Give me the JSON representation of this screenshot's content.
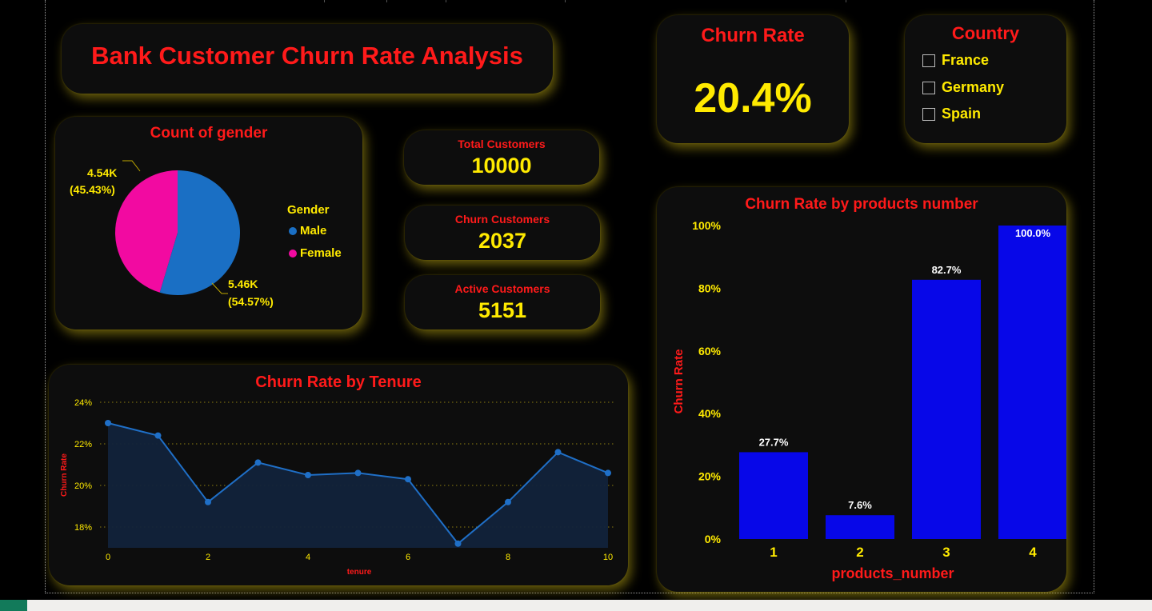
{
  "dashboard": {
    "title": "Bank Customer Churn Rate Analysis"
  },
  "kpis": {
    "churn_rate": {
      "label": "Churn Rate",
      "value": "20.4%"
    },
    "total_customers": {
      "label": "Total Customers",
      "value": "10000"
    },
    "churn_customers": {
      "label": "Churn Customers",
      "value": "2037"
    },
    "active_customers": {
      "label": "Active Customers",
      "value": "5151"
    }
  },
  "country_filter": {
    "title": "Country",
    "options": [
      {
        "label": "France",
        "checked": false
      },
      {
        "label": "Germany",
        "checked": false
      },
      {
        "label": "Spain",
        "checked": false
      }
    ]
  },
  "colors": {
    "title_red": "#ff1a1a",
    "value_yellow": "#ffea00",
    "male_blue": "#1a6fc4",
    "female_pink": "#f20aa1",
    "bar_blue": "#0707e8",
    "line_blue": "#1f6fc7",
    "card_bg": "#0d0d0d"
  },
  "gender_chart": {
    "title": "Count of gender",
    "legend_title": "Gender",
    "female_label_value": "4.54K",
    "female_label_pct": "(45.43%)",
    "male_label_value": "5.46K",
    "male_label_pct": "(54.57%)"
  },
  "chart_data": [
    {
      "type": "pie",
      "title": "Count of gender",
      "legend_title": "Gender",
      "slices": [
        {
          "name": "Male",
          "value": 5460,
          "percent": 54.57,
          "color": "#1a6fc4"
        },
        {
          "name": "Female",
          "value": 4540,
          "percent": 45.43,
          "color": "#f20aa1"
        }
      ]
    },
    {
      "type": "bar",
      "title": "Churn Rate by products number",
      "xlabel": "products_number",
      "ylabel": "Churn Rate",
      "categories": [
        "1",
        "2",
        "3",
        "4"
      ],
      "values": [
        27.7,
        7.6,
        82.7,
        100.0
      ],
      "data_labels": [
        "27.7%",
        "7.6%",
        "82.7%",
        "100.0%"
      ],
      "ylim": [
        0,
        100
      ],
      "yticks": [
        "0%",
        "20%",
        "40%",
        "60%",
        "80%",
        "100%"
      ],
      "color": "#0707e8"
    },
    {
      "type": "area",
      "title": "Churn Rate by Tenure",
      "xlabel": "tenure",
      "ylabel": "Churn Rate",
      "x": [
        0,
        1,
        2,
        3,
        4,
        5,
        6,
        7,
        8,
        9,
        10
      ],
      "values": [
        23.0,
        22.4,
        19.2,
        21.1,
        20.5,
        20.6,
        20.3,
        17.2,
        19.2,
        21.6,
        20.6
      ],
      "xticks": [
        "0",
        "2",
        "4",
        "6",
        "8",
        "10"
      ],
      "yticks": [
        "18%",
        "20%",
        "22%",
        "24%"
      ],
      "ylim": [
        17,
        24
      ],
      "grid": true,
      "color": "#1f6fc7"
    }
  ]
}
